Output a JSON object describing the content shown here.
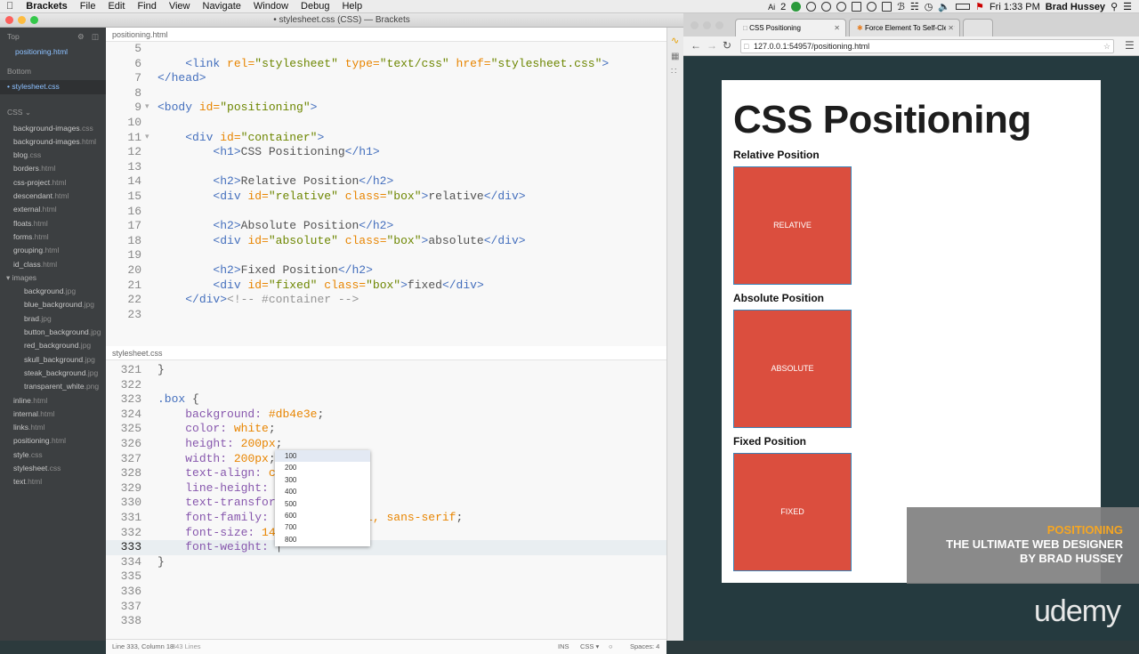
{
  "menubar": {
    "app": "Brackets",
    "items": [
      "File",
      "Edit",
      "Find",
      "View",
      "Navigate",
      "Window",
      "Debug",
      "Help"
    ],
    "tray": {
      "ai_count": "2",
      "clock": "Fri 1:33 PM",
      "user": "Brad Hussey"
    }
  },
  "brackets": {
    "title": "• stylesheet.css (CSS) — Brackets",
    "sidebar": {
      "top_label": "Top",
      "top_file": "positioning.html",
      "bottom_label": "Bottom",
      "bottom_file": "stylesheet.css",
      "project": "CSS",
      "files": [
        {
          "name": "background-images.css",
          "sub": false
        },
        {
          "name": "background-images.html",
          "sub": false
        },
        {
          "name": "blog.css",
          "sub": false
        },
        {
          "name": "borders.html",
          "sub": false
        },
        {
          "name": "css-project.html",
          "sub": false
        },
        {
          "name": "descendant.html",
          "sub": false
        },
        {
          "name": "external.html",
          "sub": false
        },
        {
          "name": "floats.html",
          "sub": false
        },
        {
          "name": "forms.html",
          "sub": false
        },
        {
          "name": "grouping.html",
          "sub": false
        },
        {
          "name": "id_class.html",
          "sub": false
        },
        {
          "name": "images",
          "sub": false,
          "folder": true
        },
        {
          "name": "background.jpg",
          "sub": true
        },
        {
          "name": "blue_background.jpg",
          "sub": true
        },
        {
          "name": "brad.jpg",
          "sub": true
        },
        {
          "name": "button_background.jpg",
          "sub": true
        },
        {
          "name": "red_background.jpg",
          "sub": true
        },
        {
          "name": "skull_background.jpg",
          "sub": true
        },
        {
          "name": "steak_background.jpg",
          "sub": true
        },
        {
          "name": "transparent_white.png",
          "sub": true
        },
        {
          "name": "inline.html",
          "sub": false
        },
        {
          "name": "internal.html",
          "sub": false
        },
        {
          "name": "links.html",
          "sub": false
        },
        {
          "name": "positioning.html",
          "sub": false
        },
        {
          "name": "style.css",
          "sub": false
        },
        {
          "name": "stylesheet.css",
          "sub": false
        },
        {
          "name": "text.html",
          "sub": false
        }
      ]
    },
    "top_pane": {
      "filename": "positioning.html",
      "lines": [
        {
          "n": "5",
          "html": ""
        },
        {
          "n": "6",
          "html": "    <span class='tag'>&lt;link</span> <span class='attr'>rel=</span><span class='str'>\"stylesheet\"</span> <span class='attr'>type=</span><span class='str'>\"text/css\"</span> <span class='attr'>href=</span><span class='str'>\"stylesheet.css\"</span><span class='tag'>&gt;</span>"
        },
        {
          "n": "7",
          "html": "<span class='tag'>&lt;/head&gt;</span>"
        },
        {
          "n": "8",
          "html": ""
        },
        {
          "n": "9",
          "html": "<span class='tag'>&lt;body</span> <span class='attr'>id=</span><span class='str'>\"positioning\"</span><span class='tag'>&gt;</span>"
        },
        {
          "n": "10",
          "html": ""
        },
        {
          "n": "11",
          "html": "    <span class='tag'>&lt;div</span> <span class='attr'>id=</span><span class='str'>\"container\"</span><span class='tag'>&gt;</span>"
        },
        {
          "n": "12",
          "html": "        <span class='tag'>&lt;h1&gt;</span>CSS Positioning<span class='tag'>&lt;/h1&gt;</span>"
        },
        {
          "n": "13",
          "html": ""
        },
        {
          "n": "14",
          "html": "        <span class='tag'>&lt;h2&gt;</span>Relative Position<span class='tag'>&lt;/h2&gt;</span>"
        },
        {
          "n": "15",
          "html": "        <span class='tag'>&lt;div</span> <span class='attr'>id=</span><span class='str'>\"relative\"</span> <span class='attr'>class=</span><span class='str'>\"box\"</span><span class='tag'>&gt;</span>relative<span class='tag'>&lt;/div&gt;</span>"
        },
        {
          "n": "16",
          "html": ""
        },
        {
          "n": "17",
          "html": "        <span class='tag'>&lt;h2&gt;</span>Absolute Position<span class='tag'>&lt;/h2&gt;</span>"
        },
        {
          "n": "18",
          "html": "        <span class='tag'>&lt;div</span> <span class='attr'>id=</span><span class='str'>\"absolute\"</span> <span class='attr'>class=</span><span class='str'>\"box\"</span><span class='tag'>&gt;</span>absolute<span class='tag'>&lt;/div&gt;</span>"
        },
        {
          "n": "19",
          "html": ""
        },
        {
          "n": "20",
          "html": "        <span class='tag'>&lt;h2&gt;</span>Fixed Position<span class='tag'>&lt;/h2&gt;</span>"
        },
        {
          "n": "21",
          "html": "        <span class='tag'>&lt;div</span> <span class='attr'>id=</span><span class='str'>\"fixed\"</span> <span class='attr'>class=</span><span class='str'>\"box\"</span><span class='tag'>&gt;</span>fixed<span class='tag'>&lt;/div&gt;</span>"
        },
        {
          "n": "22",
          "html": "    <span class='tag'>&lt;/div&gt;</span><span class='com'>&lt;!-- #container --&gt;</span>"
        },
        {
          "n": "23",
          "html": ""
        }
      ]
    },
    "bottom_pane": {
      "filename": "stylesheet.css",
      "lines": [
        {
          "n": "321",
          "html": "}"
        },
        {
          "n": "322",
          "html": ""
        },
        {
          "n": "323",
          "html": "<span class='sel-css'>.box</span> {"
        },
        {
          "n": "324",
          "html": "    <span class='prop'>background:</span> <span class='val'>#db4e3e</span>;"
        },
        {
          "n": "325",
          "html": "    <span class='prop'>color:</span> <span class='val'>white</span>;"
        },
        {
          "n": "326",
          "html": "    <span class='prop'>height:</span> <span class='val'>200px</span>;"
        },
        {
          "n": "327",
          "html": "    <span class='prop'>width:</span> <span class='val'>200px</span>;"
        },
        {
          "n": "328",
          "html": "    <span class='prop'>text-align:</span> <span class='val'>c</span>"
        },
        {
          "n": "329",
          "html": "    <span class='prop'>line-height:</span>"
        },
        {
          "n": "330",
          "html": "    <span class='prop'>text-transfor</span>"
        },
        {
          "n": "331",
          "html": "    <span class='prop'>font-family:</span>            <span class='val'>ial, sans-serif</span>;"
        },
        {
          "n": "332",
          "html": "    <span class='prop'>font-size:</span> <span class='val'>14</span>"
        },
        {
          "n": "333",
          "html": "    <span class='prop'>font-weight:</span> |"
        },
        {
          "n": "334",
          "html": "}"
        },
        {
          "n": "335",
          "html": ""
        },
        {
          "n": "336",
          "html": ""
        },
        {
          "n": "337",
          "html": ""
        },
        {
          "n": "338",
          "html": ""
        }
      ],
      "current_line": "333"
    },
    "hints": [
      "100",
      "200",
      "300",
      "400",
      "500",
      "600",
      "700",
      "800"
    ],
    "status": {
      "cursor": "Line 333, Column 18",
      "lines": "343 Lines",
      "mode": "INS",
      "lang": "CSS",
      "spaces": "Spaces: 4"
    }
  },
  "chrome": {
    "tabs": [
      "CSS Positioning",
      "Force Element To Self-Clear"
    ],
    "url": "127.0.0.1:54957/positioning.html",
    "page": {
      "h1": "CSS Positioning",
      "sections": [
        {
          "h2": "Relative Position",
          "box": "relative"
        },
        {
          "h2": "Absolute Position",
          "box": "absolute"
        },
        {
          "h2": "Fixed Position",
          "box": "fixed"
        }
      ]
    }
  },
  "overlay": {
    "topic": "POSITIONING",
    "line1": "THE ULTIMATE WEB DESIGNER",
    "line2": "BY BRAD HUSSEY",
    "brand": "udemy"
  }
}
